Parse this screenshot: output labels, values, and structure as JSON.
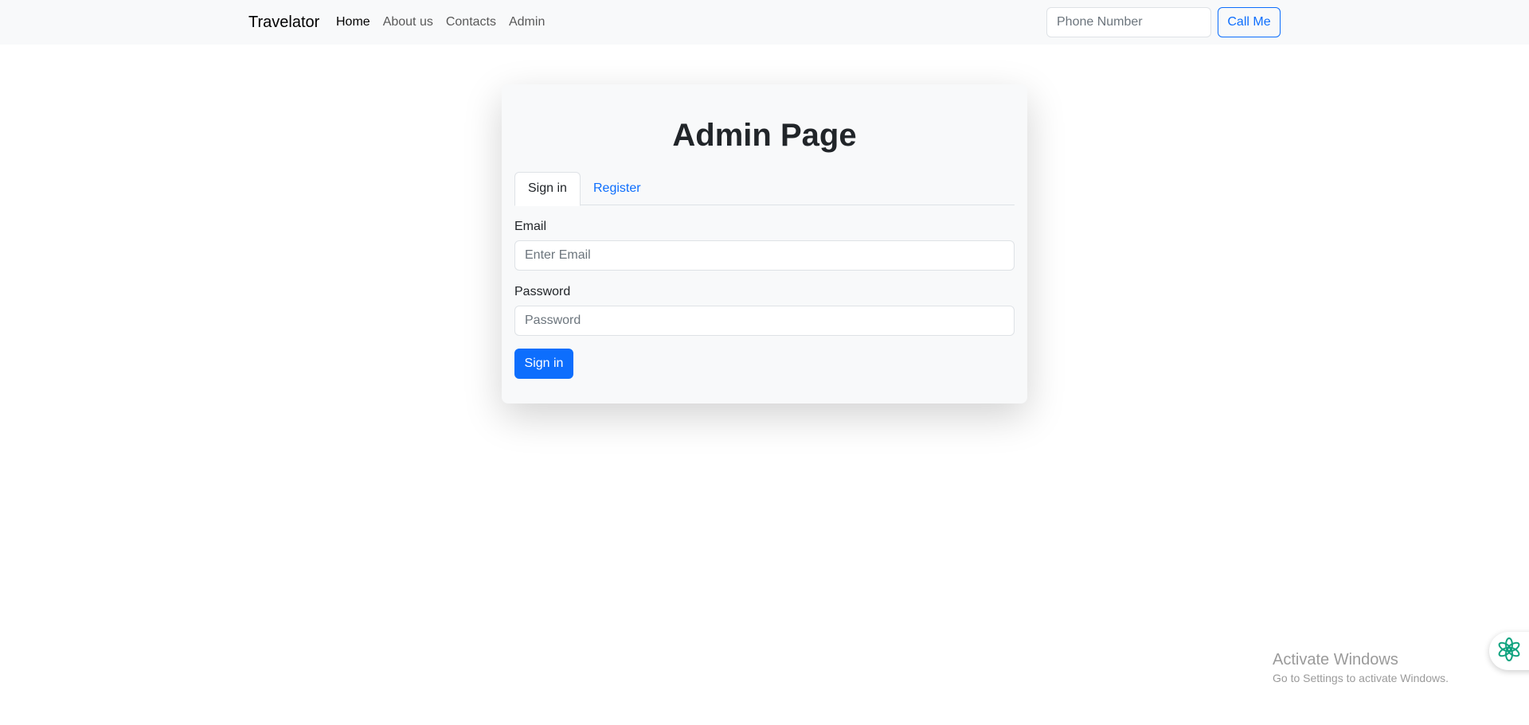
{
  "navbar": {
    "brand": "Travelator",
    "links": [
      {
        "label": "Home",
        "active": true
      },
      {
        "label": "About us",
        "active": false
      },
      {
        "label": "Contacts",
        "active": false
      },
      {
        "label": "Admin",
        "active": false
      }
    ],
    "phone_placeholder": "Phone Number",
    "call_button": "Call Me"
  },
  "card": {
    "title": "Admin Page",
    "tabs": [
      {
        "label": "Sign in",
        "active": true
      },
      {
        "label": "Register",
        "active": false
      }
    ],
    "email_label": "Email",
    "email_placeholder": "Enter Email",
    "password_label": "Password",
    "password_placeholder": "Password",
    "submit_button": "Sign in"
  },
  "watermark": {
    "title": "Activate Windows",
    "subtitle": "Go to Settings to activate Windows."
  },
  "assistant": {
    "icon": "swirl-flower-icon",
    "color": "#10a37f"
  },
  "colors": {
    "primary": "#0d6efd",
    "navbar_bg": "#f8f9fa",
    "card_bg": "#f8f9fa"
  }
}
